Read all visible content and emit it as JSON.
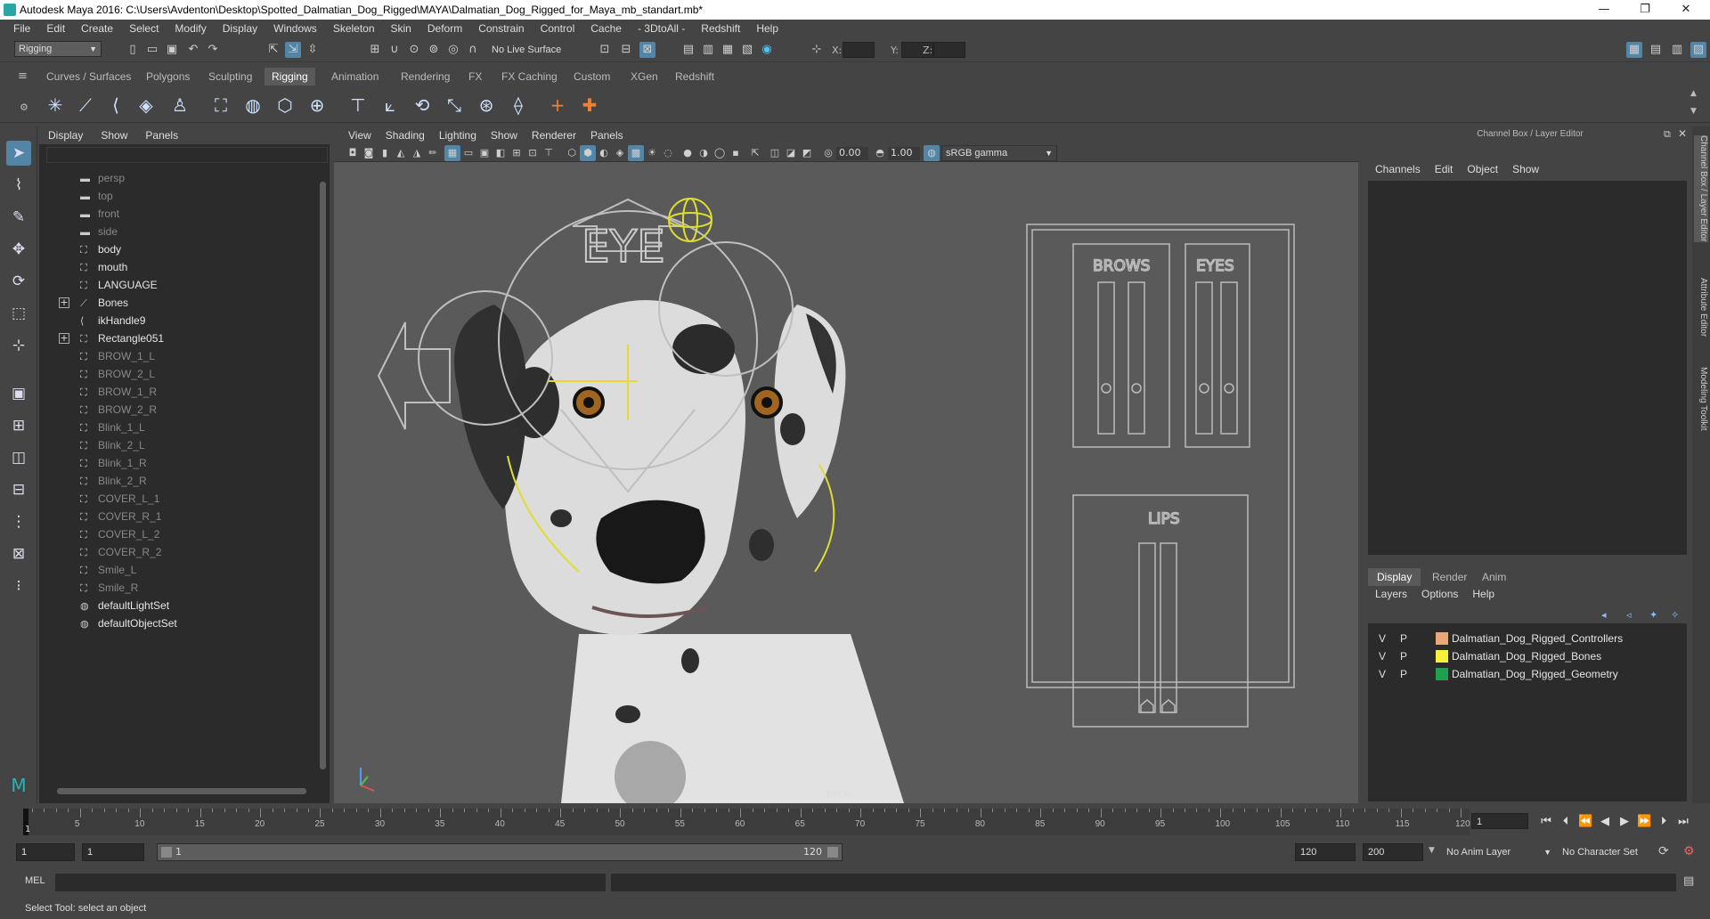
{
  "window": {
    "title": "Autodesk Maya 2016: C:\\Users\\Avdenton\\Desktop\\Spotted_Dalmatian_Dog_Rigged\\MAYA\\Dalmatian_Dog_Rigged_for_Maya_mb_standart.mb*",
    "minimize": "—",
    "maximize": "❐",
    "close": "✕"
  },
  "menu": [
    "File",
    "Edit",
    "Create",
    "Select",
    "Modify",
    "Display",
    "Windows",
    "Skeleton",
    "Skin",
    "Deform",
    "Constrain",
    "Control",
    "Cache",
    "- 3DtoAll -",
    "Redshift",
    "Help"
  ],
  "status": {
    "menuset": "Rigging",
    "live_surface": "No Live Surface",
    "x_label": "X:",
    "y_label": "Y:",
    "z_label": "Z:"
  },
  "shelf_tabs": [
    "Curves / Surfaces",
    "Polygons",
    "Sculpting",
    "Rigging",
    "Animation",
    "Rendering",
    "FX",
    "FX Caching",
    "Custom",
    "XGen",
    "Redshift"
  ],
  "shelf_active": "Rigging",
  "outliner": {
    "menu": [
      "Display",
      "Show",
      "Panels"
    ],
    "items": [
      {
        "label": "persp",
        "icon": "camera-icon",
        "dim": true
      },
      {
        "label": "top",
        "icon": "camera-icon",
        "dim": true
      },
      {
        "label": "front",
        "icon": "camera-icon",
        "dim": true
      },
      {
        "label": "side",
        "icon": "camera-icon",
        "dim": true
      },
      {
        "label": "body",
        "icon": "mesh-icon",
        "dim": false
      },
      {
        "label": "mouth",
        "icon": "mesh-icon",
        "dim": false
      },
      {
        "label": "LANGUAGE",
        "icon": "mesh-icon",
        "dim": false
      },
      {
        "label": "Bones",
        "icon": "joint-icon",
        "dim": false,
        "expand": true
      },
      {
        "label": "ikHandle9",
        "icon": "ik-handle-icon",
        "dim": false
      },
      {
        "label": "Rectangle051",
        "icon": "curve-icon",
        "dim": false,
        "expand": true
      },
      {
        "label": "BROW_1_L",
        "icon": "curve-icon",
        "dim": true
      },
      {
        "label": "BROW_2_L",
        "icon": "curve-icon",
        "dim": true
      },
      {
        "label": "BROW_1_R",
        "icon": "curve-icon",
        "dim": true
      },
      {
        "label": "BROW_2_R",
        "icon": "curve-icon",
        "dim": true
      },
      {
        "label": "Blink_1_L",
        "icon": "curve-icon",
        "dim": true
      },
      {
        "label": "Blink_2_L",
        "icon": "curve-icon",
        "dim": true
      },
      {
        "label": "Blink_1_R",
        "icon": "curve-icon",
        "dim": true
      },
      {
        "label": "Blink_2_R",
        "icon": "curve-icon",
        "dim": true
      },
      {
        "label": "COVER_L_1",
        "icon": "curve-icon",
        "dim": true
      },
      {
        "label": "COVER_R_1",
        "icon": "curve-icon",
        "dim": true
      },
      {
        "label": "COVER_L_2",
        "icon": "curve-icon",
        "dim": true
      },
      {
        "label": "COVER_R_2",
        "icon": "curve-icon",
        "dim": true
      },
      {
        "label": "Smile_L",
        "icon": "curve-icon",
        "dim": true
      },
      {
        "label": "Smile_R",
        "icon": "curve-icon",
        "dim": true
      },
      {
        "label": "defaultLightSet",
        "icon": "set-icon",
        "dim": false
      },
      {
        "label": "defaultObjectSet",
        "icon": "set-icon",
        "dim": false
      }
    ]
  },
  "viewport": {
    "menu": [
      "View",
      "Shading",
      "Lighting",
      "Show",
      "Renderer",
      "Panels"
    ],
    "exposure": "0.00",
    "gamma": "1.00",
    "colorspace": "sRGB gamma",
    "camera": "persp",
    "rig_labels": {
      "eye": "EYE",
      "brows": "BROWS",
      "eyes": "EYES",
      "lips": "LIPS"
    }
  },
  "channel_box": {
    "title": "Channel Box / Layer Editor",
    "menu": [
      "Channels",
      "Edit",
      "Object",
      "Show"
    ]
  },
  "layer_editor": {
    "tabs": [
      "Display",
      "Render",
      "Anim"
    ],
    "active": "Display",
    "menu": [
      "Layers",
      "Options",
      "Help"
    ],
    "layers": [
      {
        "v": "V",
        "p": "P",
        "name": "Dalmatian_Dog_Rigged_Controllers",
        "color": "#e8a878"
      },
      {
        "v": "V",
        "p": "P",
        "name": "Dalmatian_Dog_Rigged_Bones",
        "color": "#f5f03a"
      },
      {
        "v": "V",
        "p": "P",
        "name": "Dalmatian_Dog_Rigged_Geometry",
        "color": "#1ea050"
      }
    ]
  },
  "side_tabs": [
    "Channel Box / Layer Editor",
    "Attribute Editor",
    "Modeling Toolkit"
  ],
  "timeline": {
    "ticks": [
      "5",
      "10",
      "15",
      "20",
      "25",
      "30",
      "35",
      "40",
      "45",
      "50",
      "55",
      "60",
      "65",
      "70",
      "75",
      "80",
      "85",
      "90",
      "95",
      "100",
      "105",
      "110",
      "115",
      "120"
    ],
    "start_marker": "1",
    "current": "1"
  },
  "range": {
    "start": "1",
    "start2": "1",
    "slider_start": "1",
    "slider_end": "120",
    "end": "120",
    "end2": "200",
    "anim_layer": "No Anim Layer",
    "char_set": "No Character Set"
  },
  "command": {
    "label": "MEL"
  },
  "help_line": "Select Tool: select an object"
}
